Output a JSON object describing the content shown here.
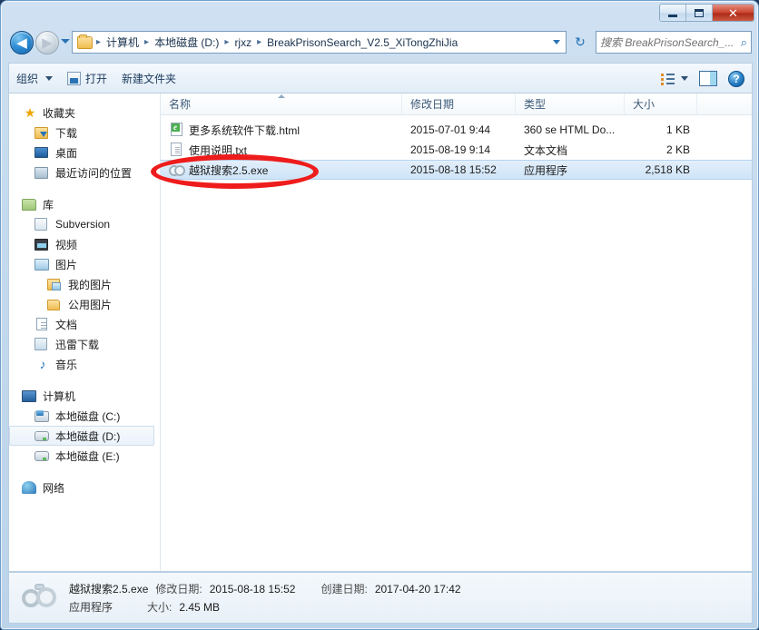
{
  "window": {
    "buttons": {
      "minimize": "–",
      "maximize": "□",
      "close": "✕"
    }
  },
  "nav": {
    "back_icon": "◀",
    "forward_icon": "▶",
    "recent_dropdown": "▾",
    "refresh_icon": "↻",
    "breadcrumbs": [
      "计算机",
      "本地磁盘 (D:)",
      "rjxz",
      "BreakPrisonSearch_V2.5_XiTongZhiJia"
    ],
    "separator": "▸",
    "address_dropdown": "▾"
  },
  "search": {
    "placeholder": "搜索 BreakPrisonSearch_...",
    "icon": "⌕"
  },
  "toolbar": {
    "organize": "组织",
    "open": "打开",
    "new_folder": "新建文件夹",
    "caret": "▾",
    "help": "?"
  },
  "sidebar": {
    "groups": [
      {
        "header": {
          "label": "收藏夹",
          "icon": "star-icon",
          "cls": "ic-star",
          "glyph": "★",
          "indent": 14
        },
        "items": [
          {
            "label": "下载",
            "icon": "downloads-icon",
            "cls": "ic-dl",
            "indent": 28
          },
          {
            "label": "桌面",
            "icon": "desktop-icon",
            "cls": "ic-desk",
            "indent": 28
          },
          {
            "label": "最近访问的位置",
            "icon": "recent-places-icon",
            "cls": "ic-recent",
            "indent": 28
          }
        ]
      },
      {
        "header": {
          "label": "库",
          "icon": "library-icon",
          "cls": "ic-lib",
          "indent": 14
        },
        "items": [
          {
            "label": "Subversion",
            "icon": "subversion-icon",
            "cls": "ic-svn",
            "indent": 28
          },
          {
            "label": "视频",
            "icon": "videos-icon",
            "cls": "ic-video",
            "indent": 28
          },
          {
            "label": "图片",
            "icon": "pictures-icon",
            "cls": "ic-pic",
            "indent": 28
          },
          {
            "label": "我的图片",
            "icon": "my-pictures-icon",
            "cls": "ic-mypic",
            "indent": 42
          },
          {
            "label": "公用图片",
            "icon": "public-pictures-icon",
            "cls": "ic-folder",
            "indent": 42
          },
          {
            "label": "文档",
            "icon": "documents-icon",
            "cls": "ic-doc",
            "indent": 28
          },
          {
            "label": "迅雷下载",
            "icon": "thunder-download-icon",
            "cls": "ic-thunder",
            "indent": 28
          },
          {
            "label": "音乐",
            "icon": "music-icon",
            "cls": "ic-music",
            "glyph": "♪",
            "indent": 28
          }
        ]
      },
      {
        "header": {
          "label": "计算机",
          "icon": "computer-icon",
          "cls": "ic-pc",
          "indent": 14
        },
        "items": [
          {
            "label": "本地磁盘 (C:)",
            "icon": "system-drive-icon",
            "cls": "ic-drivec",
            "indent": 28
          },
          {
            "label": "本地磁盘 (D:)",
            "icon": "drive-icon",
            "cls": "ic-drive",
            "indent": 28,
            "selected": true
          },
          {
            "label": "本地磁盘 (E:)",
            "icon": "drive-icon",
            "cls": "ic-drive",
            "indent": 28
          }
        ]
      },
      {
        "header": {
          "label": "网络",
          "icon": "network-icon",
          "cls": "ic-net",
          "indent": 14
        },
        "items": []
      }
    ]
  },
  "filelist": {
    "columns": [
      {
        "label": "名称",
        "key": "name",
        "cls": "c-name",
        "sorted": true
      },
      {
        "label": "修改日期",
        "key": "date",
        "cls": "c-date",
        "sorted": false
      },
      {
        "label": "类型",
        "key": "type",
        "cls": "c-type",
        "sorted": false
      },
      {
        "label": "大小",
        "key": "size",
        "cls": "c-size",
        "sorted": false
      }
    ],
    "rows": [
      {
        "name": "更多系统软件下载.html",
        "date": "2015-07-01 9:44",
        "type": "360 se HTML Do...",
        "size": "1 KB",
        "icon": "html-file-icon",
        "iconcls": "ic-html",
        "selected": false
      },
      {
        "name": "使用说明.txt",
        "date": "2015-08-19 9:14",
        "type": "文本文档",
        "size": "2 KB",
        "icon": "text-file-icon",
        "iconcls": "ic-txt",
        "selected": false
      },
      {
        "name": "越狱搜索2.5.exe",
        "date": "2015-08-18 15:52",
        "type": "应用程序",
        "size": "2,518 KB",
        "icon": "handcuffs-exe-icon",
        "iconcls": "ic-cuffs",
        "selected": true
      }
    ]
  },
  "annotation": {
    "shape": "red-ellipse",
    "color": "#ee1c1c",
    "targets": "越狱搜索2.5.exe"
  },
  "statusbar": {
    "filename": "越狱搜索2.5.exe",
    "modified_label": "修改日期:",
    "modified_value": "2015-08-18 15:52",
    "created_label": "创建日期:",
    "created_value": "2017-04-20 17:42",
    "filetype": "应用程序",
    "size_label": "大小:",
    "size_value": "2.45 MB",
    "icon": "handcuffs-icon"
  }
}
